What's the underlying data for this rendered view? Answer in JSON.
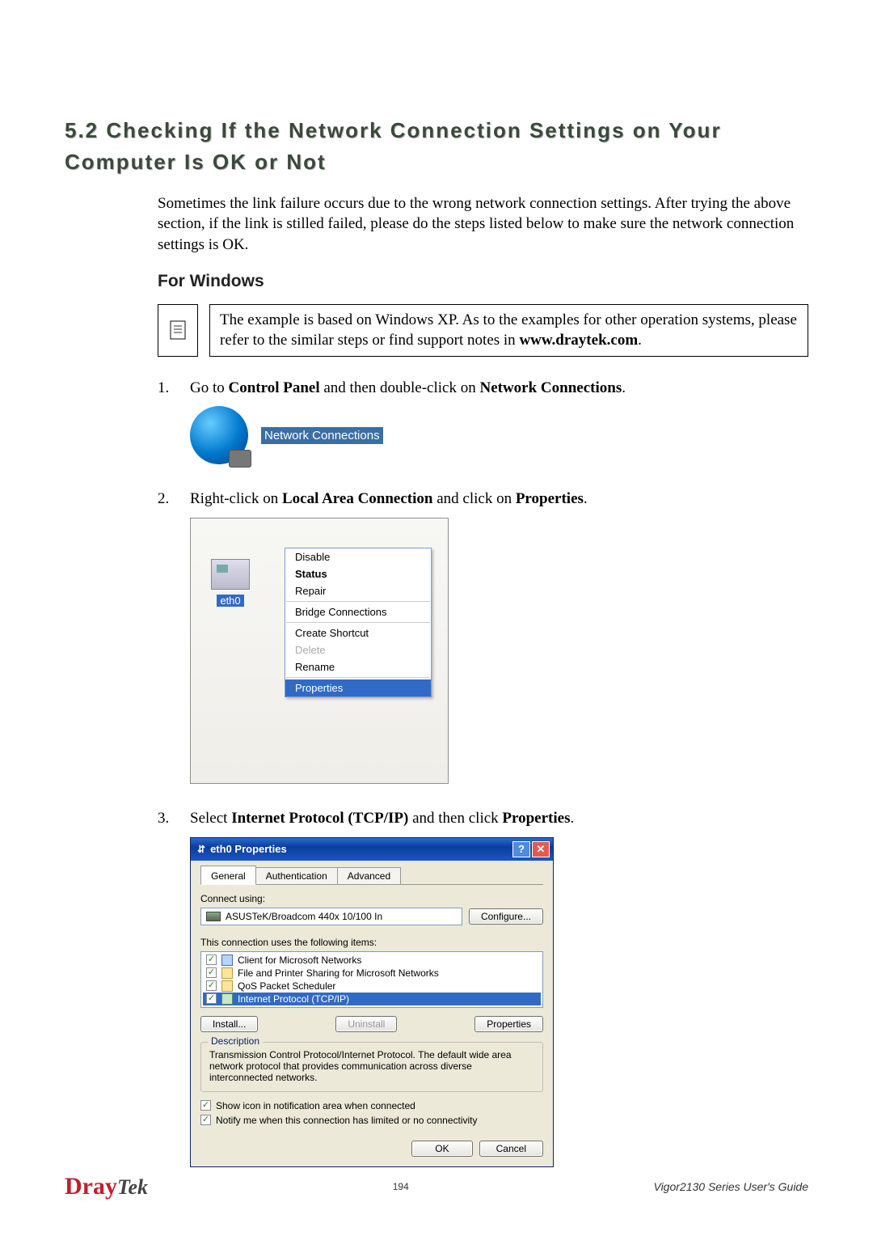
{
  "section_title": "5.2 Checking If the Network Connection Settings on Your Computer Is OK or Not",
  "intro": "Sometimes the link failure occurs due to the wrong network connection settings. After trying the above section, if the link is stilled failed, please do the steps listed below to make sure the network connection settings is OK.",
  "subheading": "For Windows",
  "note_text_a": "The example is based on Windows XP. As to the examples for other operation systems, please refer to the similar steps or find support notes in ",
  "note_site": "www.draytek.com",
  "note_text_b": ".",
  "steps": {
    "s1_num": "1.",
    "s1_a": "Go to ",
    "s1_b": "Control Panel",
    "s1_c": " and then double-click on ",
    "s1_d": "Network Connections",
    "s1_e": ".",
    "s2_num": "2.",
    "s2_a": "Right-click on ",
    "s2_b": "Local Area Connection",
    "s2_c": " and click on ",
    "s2_d": "Properties",
    "s2_e": ".",
    "s3_num": "3.",
    "s3_a": "Select ",
    "s3_b": "Internet Protocol (TCP/IP)",
    "s3_c": " and then click ",
    "s3_d": "Properties",
    "s3_e": "."
  },
  "fig1": {
    "label": "Network Connections"
  },
  "fig2": {
    "nic_label": "eth0",
    "menu": {
      "disable": "Disable",
      "status": "Status",
      "repair": "Repair",
      "bridge": "Bridge Connections",
      "shortcut": "Create Shortcut",
      "delete": "Delete",
      "rename": "Rename",
      "properties": "Properties"
    }
  },
  "fig3": {
    "title": "eth0 Properties",
    "help_btn": "?",
    "close_btn": "✕",
    "tabs": {
      "general": "General",
      "auth": "Authentication",
      "adv": "Advanced"
    },
    "connect_using": "Connect using:",
    "adapter": "ASUSTeK/Broadcom 440x 10/100 In",
    "configure": "Configure...",
    "items_label": "This connection uses the following items:",
    "items": {
      "client": "Client for Microsoft Networks",
      "fileprint": "File and Printer Sharing for Microsoft Networks",
      "qos": "QoS Packet Scheduler",
      "tcpip": "Internet Protocol (TCP/IP)"
    },
    "install": "Install...",
    "uninstall": "Uninstall",
    "properties": "Properties",
    "desc_legend": "Description",
    "desc_text": "Transmission Control Protocol/Internet Protocol. The default wide area network protocol that provides communication across diverse interconnected networks.",
    "show_icon": "Show icon in notification area when connected",
    "notify": "Notify me when this connection has limited or no connectivity",
    "ok": "OK",
    "cancel": "Cancel"
  },
  "footer": {
    "brand_d": "Dray",
    "brand_rest": "Tek",
    "page": "194",
    "guide": "Vigor2130 Series User's Guide"
  }
}
